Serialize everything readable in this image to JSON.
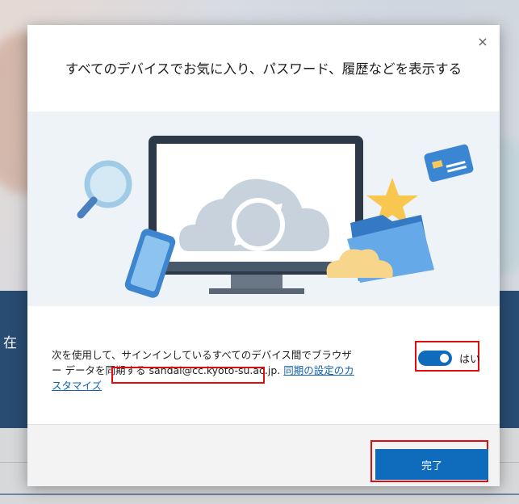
{
  "background": {
    "band_text": "在"
  },
  "modal": {
    "title": "すべてのデバイスでお気に入り、パスワード、履歴などを表示する",
    "close_glyph": "×",
    "description_prefix": "次を使用して、サインインしているすべてのデバイス間でブラウザー データを同期する",
    "email": "sandai@cc.kyoto-su.ac.jp.",
    "customize_link": "同期の設定のカスタマイズ",
    "toggle": {
      "state": "on",
      "label": "はい"
    },
    "done_button": "完了",
    "colors": {
      "accent": "#0f6cbd",
      "highlight_box": "#e00d10",
      "illustration_bg": "#eef3f8"
    },
    "icons": [
      "close-icon",
      "magnifier-icon",
      "phone-icon",
      "monitor-icon",
      "cloud-sync-icon",
      "credit-card-icon",
      "star-icon",
      "folder-icon"
    ]
  }
}
